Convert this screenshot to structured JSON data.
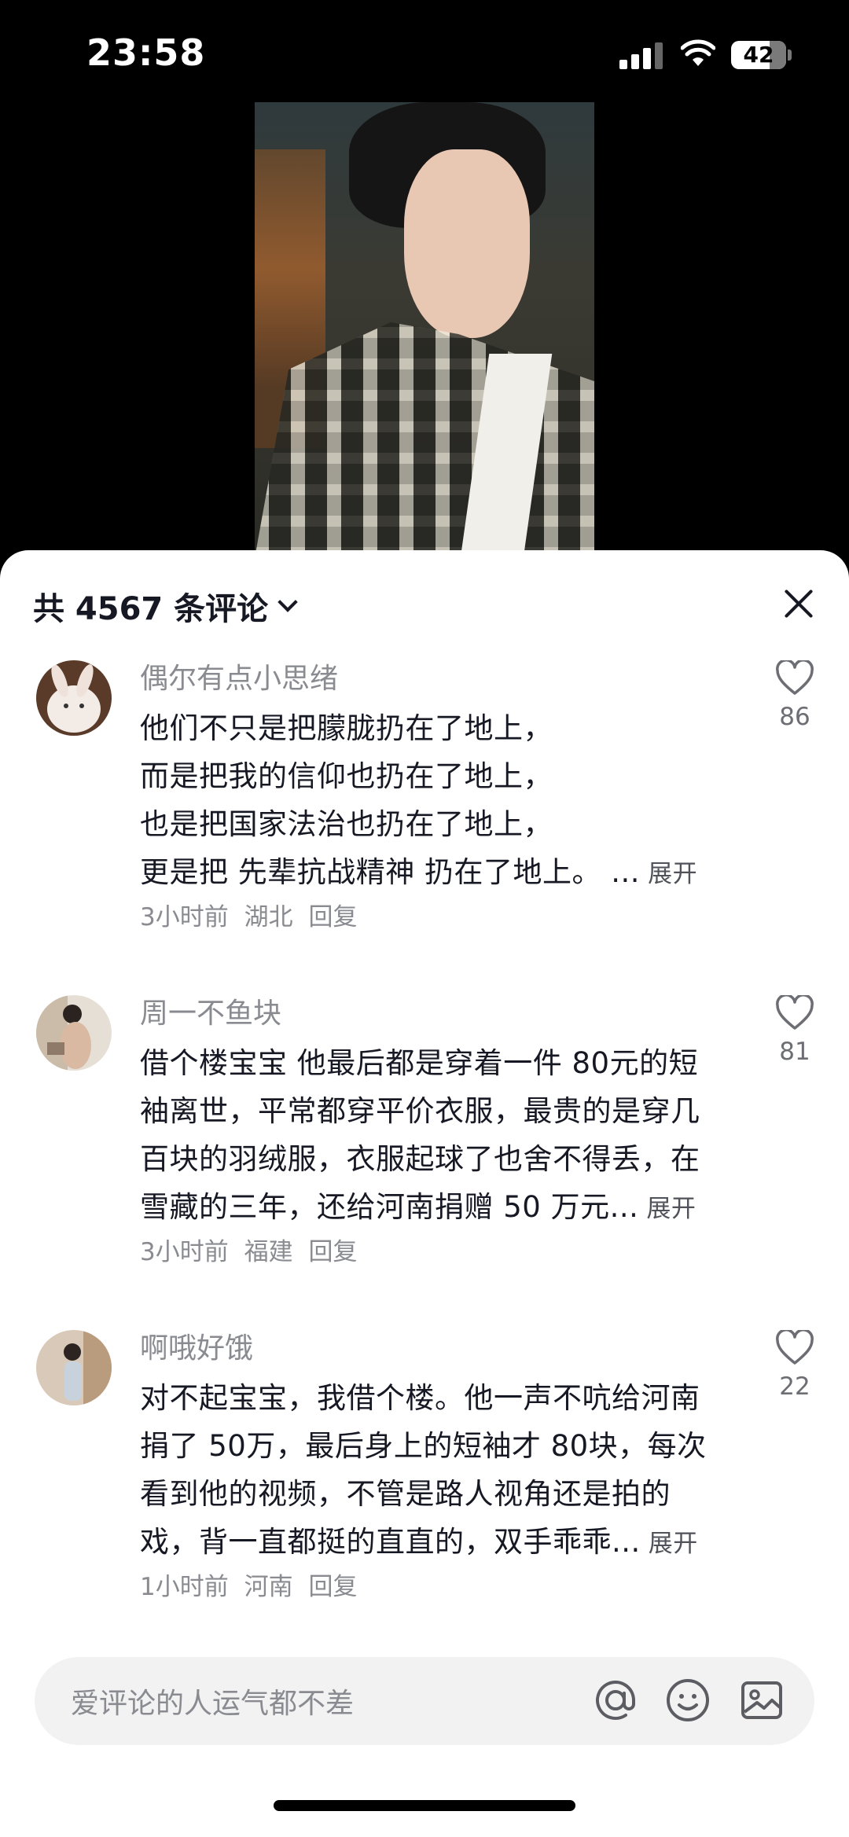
{
  "status_bar": {
    "time": "23:58",
    "battery": "42"
  },
  "sheet": {
    "title": "共 4567 条评论"
  },
  "comments": [
    {
      "user": "偶尔有点小思绪",
      "lines": [
        "他们不只是把朦胧扔在了地上，",
        "而是把我的信仰也扔在了地上，",
        "也是把国家法治也扔在了地上，",
        "更是把 先辈抗战精神 扔在了地上。 ..."
      ],
      "expand": "展开",
      "time": "3小时前",
      "location": "湖北",
      "reply": "回复",
      "likes": "86"
    },
    {
      "user": "周一不鱼块",
      "lines": [
        "借个楼宝宝 他最后都是穿着一件 80元的短",
        "袖离世，平常都穿平价衣服，最贵的是穿几",
        "百块的羽绒服，衣服起球了也舍不得丢，在",
        "雪藏的三年，还给河南捐赠 50 万元..."
      ],
      "expand": "展开",
      "time": "3小时前",
      "location": "福建",
      "reply": "回复",
      "likes": "81"
    },
    {
      "user": "啊哦好饿",
      "lines": [
        "对不起宝宝，我借个楼。他一声不吭给河南",
        "捐了 50万，最后身上的短袖才 80块，每次",
        "看到他的视频，不管是路人视角还是拍的",
        "戏，背一直都挺的直直的，双手乖乖..."
      ],
      "expand": "展开",
      "time": "1小时前",
      "location": "河南",
      "reply": "回复",
      "likes": "22"
    }
  ],
  "input": {
    "placeholder": "爱评论的人运气都不差"
  },
  "icons": [
    "at-icon",
    "emoji-icon",
    "image-icon",
    "heart-icon",
    "close-icon",
    "chevron-down-icon"
  ],
  "colors": {
    "text": "#161823",
    "muted": "#8a8b91",
    "input_bg": "#f2f2f3"
  }
}
